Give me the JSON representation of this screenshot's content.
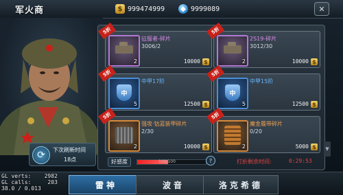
{
  "header": {
    "title": "军火商",
    "gold": "999474999",
    "diamond": "9999089",
    "close_label": "✕"
  },
  "refresh": {
    "label": "下次刷新时间",
    "time": "18点"
  },
  "items": [
    {
      "discount": "5折",
      "name": "征服者-碎片",
      "count": "3006/2",
      "qty": "2",
      "price": "10000"
    },
    {
      "discount": "5折",
      "name": "2S19-碎片",
      "count": "3012/30",
      "qty": "2",
      "price": "10000"
    },
    {
      "discount": "5折",
      "name": "中甲17阶",
      "count": "",
      "qty": "5",
      "price": "12500"
    },
    {
      "discount": "5折",
      "name": "中甲15阶",
      "count": "",
      "qty": "5",
      "price": "12500"
    },
    {
      "discount": "5折",
      "name": "强攻·钴蓝装甲碎片",
      "count": "2/30",
      "qty": "2",
      "price": "10000"
    },
    {
      "discount": "5折",
      "name": "魔金履带碎片",
      "count": "0/20",
      "qty": "2",
      "price": "5000"
    }
  ],
  "favor": {
    "label": "好感度",
    "value": "100/100",
    "fill_fraction": 0.45
  },
  "discount_timer": {
    "label": "打折剩余时间:",
    "time": "0:29:53"
  },
  "tabs": [
    {
      "label": "雷神",
      "active": true
    },
    {
      "label": "波音",
      "active": false
    },
    {
      "label": "洛克希德",
      "active": false
    }
  ],
  "debug": {
    "line1": "GL verts:    2982",
    "line2": "GL calls:     203",
    "line3": "38.0 / 0.013"
  },
  "colors": {
    "accent_blue": "#2d6ea4",
    "discount_red": "#c8221a",
    "purple_name": "#d98be8",
    "blue_name": "#66b5ff",
    "orange_name": "#f0a050"
  }
}
